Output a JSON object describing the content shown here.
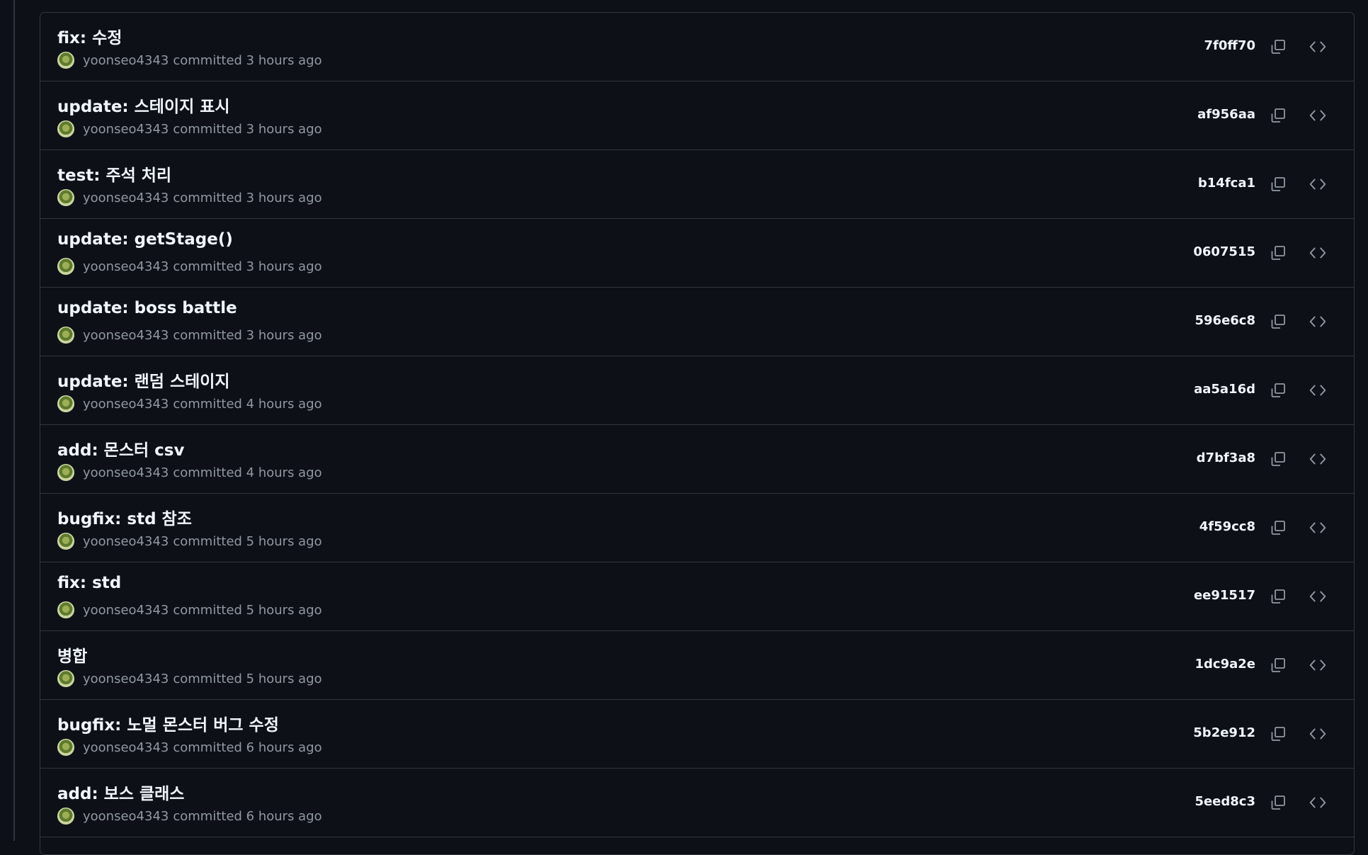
{
  "commits": [
    {
      "message": "fix: 수정",
      "author": "yoonseo4343",
      "time": "committed 3 hours ago",
      "sha": "7f0ff70"
    },
    {
      "message": "update: 스테이지 표시",
      "author": "yoonseo4343",
      "time": "committed 3 hours ago",
      "sha": "af956aa"
    },
    {
      "message": "test: 주석 처리",
      "author": "yoonseo4343",
      "time": "committed 3 hours ago",
      "sha": "b14fca1"
    },
    {
      "message": "update: getStage()",
      "author": "yoonseo4343",
      "time": "committed 3 hours ago",
      "sha": "0607515"
    },
    {
      "message": "update: boss battle",
      "author": "yoonseo4343",
      "time": "committed 3 hours ago",
      "sha": "596e6c8"
    },
    {
      "message": "update: 랜덤 스테이지",
      "author": "yoonseo4343",
      "time": "committed 4 hours ago",
      "sha": "aa5a16d"
    },
    {
      "message": "add: 몬스터 csv",
      "author": "yoonseo4343",
      "time": "committed 4 hours ago",
      "sha": "d7bf3a8"
    },
    {
      "message": "bugfix: std 참조",
      "author": "yoonseo4343",
      "time": "committed 5 hours ago",
      "sha": "4f59cc8"
    },
    {
      "message": "fix: std",
      "author": "yoonseo4343",
      "time": "committed 5 hours ago",
      "sha": "ee91517"
    },
    {
      "message": "병합",
      "author": "yoonseo4343",
      "time": "committed 5 hours ago",
      "sha": "1dc9a2e"
    },
    {
      "message": "bugfix: 노멀 몬스터 버그 수정",
      "author": "yoonseo4343",
      "time": "committed 6 hours ago",
      "sha": "5b2e912"
    },
    {
      "message": "add: 보스 클래스",
      "author": "yoonseo4343",
      "time": "committed 6 hours ago",
      "sha": "5eed8c3"
    }
  ],
  "colors": {
    "background": "#0d1117",
    "border": "#30363d",
    "text_primary": "#f0f6fc",
    "text_muted": "#9198a1"
  },
  "icons": {
    "copy": "copy-icon",
    "browse": "code-icon"
  }
}
